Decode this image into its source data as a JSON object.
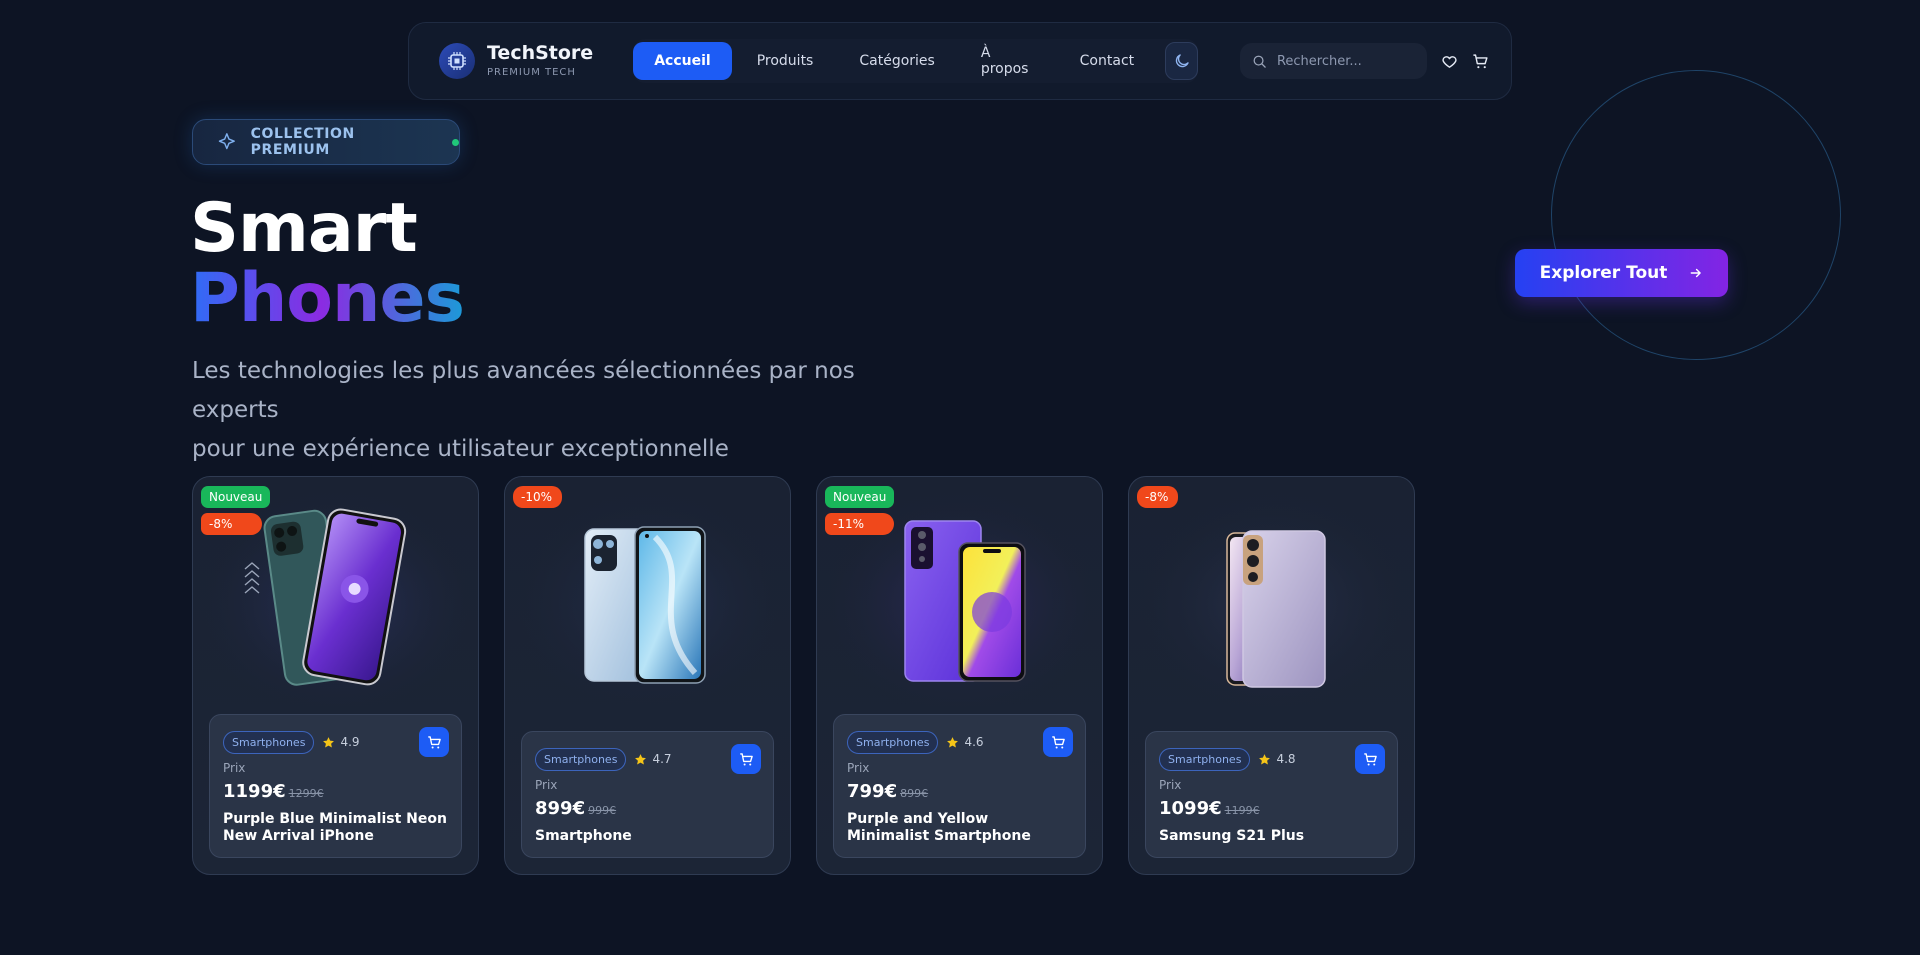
{
  "brand": {
    "name": "TechStore",
    "tagline": "PREMIUM TECH",
    "icon": "chip-icon"
  },
  "nav": {
    "items": [
      {
        "label": "Accueil",
        "active": true
      },
      {
        "label": "Produits",
        "active": false
      },
      {
        "label": "Catégories",
        "active": false
      },
      {
        "label": "À propos",
        "active": false
      },
      {
        "label": "Contact",
        "active": false
      }
    ],
    "theme_icon": "moon-icon"
  },
  "search": {
    "placeholder": "Rechercher...",
    "value": ""
  },
  "header_icons": [
    "heart-icon",
    "cart-icon"
  ],
  "hero": {
    "badge": "COLLECTION PREMIUM",
    "title_line1": "Smart",
    "title_line2": "Phones",
    "description_line1": "Les technologies les plus avancées sélectionnées par nos experts",
    "description_line2": "pour une expérience utilisateur exceptionnelle",
    "cta": "Explorer Tout"
  },
  "price_label": "Prix",
  "products": [
    {
      "tag_new": "Nouveau",
      "discount": "-8%",
      "category": "Smartphones",
      "rating": "4.9",
      "price": "1199€",
      "old_price": "1299€",
      "name": "Purple Blue Minimalist Neon New Arrival iPhone"
    },
    {
      "tag_new": "",
      "discount": "-10%",
      "category": "Smartphones",
      "rating": "4.7",
      "price": "899€",
      "old_price": "999€",
      "name": "Smartphone"
    },
    {
      "tag_new": "Nouveau",
      "discount": "-11%",
      "category": "Smartphones",
      "rating": "4.6",
      "price": "799€",
      "old_price": "899€",
      "name": "Purple and Yellow Minimalist Smartphone"
    },
    {
      "tag_new": "",
      "discount": "-8%",
      "category": "Smartphones",
      "rating": "4.8",
      "price": "1099€",
      "old_price": "1199€",
      "name": "Samsung S21 Plus"
    }
  ],
  "colors": {
    "background": "#0d1424",
    "accent": "#1d5cf5",
    "new_tag": "#19b75a",
    "discount_tag": "#f0481b",
    "star": "#f5c518"
  }
}
